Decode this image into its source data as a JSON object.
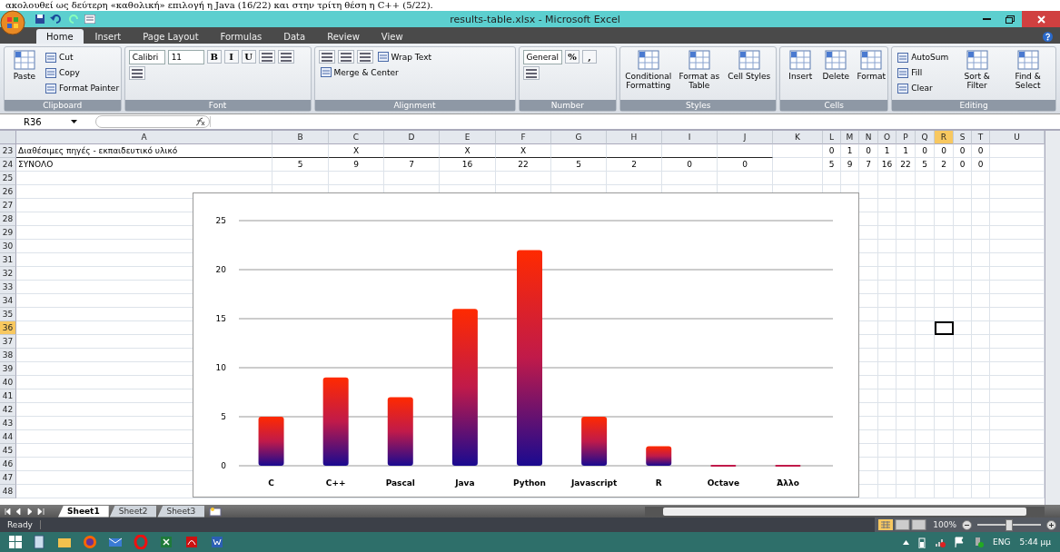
{
  "document_fragment": "ακολουθεί ως δεύτερη «καθολική» επιλογή η Java (16/22) και στην τρίτη θέση η C++ (5/22).",
  "window": {
    "title": "results-table.xlsx - Microsoft Excel"
  },
  "tabs": [
    {
      "label": "Home",
      "selected": true
    },
    {
      "label": "Insert",
      "selected": false
    },
    {
      "label": "Page Layout",
      "selected": false
    },
    {
      "label": "Formulas",
      "selected": false
    },
    {
      "label": "Data",
      "selected": false
    },
    {
      "label": "Review",
      "selected": false
    },
    {
      "label": "View",
      "selected": false
    }
  ],
  "ribbon": [
    {
      "label": "Clipboard",
      "items": [
        {
          "kind": "large",
          "label": "Paste"
        },
        {
          "kind": "small",
          "label": "Cut"
        },
        {
          "kind": "small",
          "label": "Copy"
        },
        {
          "kind": "small",
          "label": "Format Painter"
        }
      ]
    },
    {
      "label": "Font",
      "items": [
        {
          "kind": "combo",
          "label": "Calibri"
        },
        {
          "kind": "combo",
          "label": "11"
        },
        {
          "kind": "glyph",
          "label": "B"
        },
        {
          "kind": "glyph",
          "label": "I"
        },
        {
          "kind": "glyph",
          "label": "U"
        },
        {
          "kind": "icon"
        },
        {
          "kind": "icon"
        },
        {
          "kind": "icon"
        }
      ]
    },
    {
      "label": "Alignment",
      "items": [
        {
          "kind": "icon"
        },
        {
          "kind": "icon"
        },
        {
          "kind": "icon"
        },
        {
          "kind": "small",
          "label": "Wrap Text"
        },
        {
          "kind": "small",
          "label": "Merge & Center"
        }
      ]
    },
    {
      "label": "Number",
      "items": [
        {
          "kind": "combo",
          "label": "General"
        },
        {
          "kind": "glyph",
          "label": "%"
        },
        {
          "kind": "glyph",
          "label": ","
        },
        {
          "kind": "icon"
        }
      ]
    },
    {
      "label": "Styles",
      "items": [
        {
          "kind": "large",
          "label": "Conditional Formatting"
        },
        {
          "kind": "large",
          "label": "Format as Table"
        },
        {
          "kind": "large",
          "label": "Cell Styles"
        }
      ]
    },
    {
      "label": "Cells",
      "items": [
        {
          "kind": "large",
          "label": "Insert"
        },
        {
          "kind": "large",
          "label": "Delete"
        },
        {
          "kind": "large",
          "label": "Format"
        }
      ]
    },
    {
      "label": "Editing",
      "items": [
        {
          "kind": "small",
          "label": "AutoSum"
        },
        {
          "kind": "small",
          "label": "Fill"
        },
        {
          "kind": "small",
          "label": "Clear"
        },
        {
          "kind": "large",
          "label": "Sort & Filter"
        },
        {
          "kind": "large",
          "label": "Find & Select"
        }
      ]
    }
  ],
  "formula_bar": {
    "name_box": "R36"
  },
  "columns": [
    {
      "label": "A",
      "selected": false
    },
    {
      "label": "B",
      "selected": false
    },
    {
      "label": "C",
      "selected": false
    },
    {
      "label": "D",
      "selected": false
    },
    {
      "label": "E",
      "selected": false
    },
    {
      "label": "F",
      "selected": false
    },
    {
      "label": "G",
      "selected": false
    },
    {
      "label": "H",
      "selected": false
    },
    {
      "label": "I",
      "selected": false
    },
    {
      "label": "J",
      "selected": false
    },
    {
      "label": "K",
      "selected": false
    },
    {
      "label": "L",
      "selected": false
    },
    {
      "label": "M",
      "selected": false
    },
    {
      "label": "N",
      "selected": false
    },
    {
      "label": "O",
      "selected": false
    },
    {
      "label": "P",
      "selected": false
    },
    {
      "label": "Q",
      "selected": false
    },
    {
      "label": "R",
      "selected": true
    },
    {
      "label": "S",
      "selected": false
    },
    {
      "label": "T",
      "selected": false
    },
    {
      "label": "U",
      "selected": false
    }
  ],
  "rows": [
    {
      "number": "23",
      "selected": false,
      "cells": {
        "A": "Διαθέσιμες πηγές - εκπαιδευτικό υλικό",
        "C": "X",
        "E": "X",
        "F": "X",
        "L": "0",
        "M": "1",
        "N": "0",
        "O": "1",
        "P": "1",
        "Q": "0",
        "R": "0",
        "S": "0",
        "T": "0"
      }
    },
    {
      "number": "24",
      "selected": false,
      "cells": {
        "A": "ΣΥΝΟΛΟ",
        "B": "5",
        "C": "9",
        "D": "7",
        "E": "16",
        "F": "22",
        "G": "5",
        "H": "2",
        "I": "0",
        "J": "0",
        "L": "5",
        "M": "9",
        "N": "7",
        "O": "16",
        "P": "22",
        "Q": "5",
        "R": "2",
        "S": "0",
        "T": "0"
      }
    },
    {
      "number": "25",
      "selected": false
    },
    {
      "number": "26",
      "selected": false
    },
    {
      "number": "27",
      "selected": false
    },
    {
      "number": "28",
      "selected": false
    },
    {
      "number": "29",
      "selected": false
    },
    {
      "number": "30",
      "selected": false
    },
    {
      "number": "31",
      "selected": false
    },
    {
      "number": "32",
      "selected": false
    },
    {
      "number": "33",
      "selected": false
    },
    {
      "number": "34",
      "selected": false
    },
    {
      "number": "35",
      "selected": false
    },
    {
      "number": "36",
      "selected": true
    },
    {
      "number": "37",
      "selected": false
    },
    {
      "number": "38",
      "selected": false
    },
    {
      "number": "39",
      "selected": false
    },
    {
      "number": "40",
      "selected": false
    },
    {
      "number": "41",
      "selected": false
    },
    {
      "number": "42",
      "selected": false
    },
    {
      "number": "43",
      "selected": false
    },
    {
      "number": "44",
      "selected": false
    },
    {
      "number": "45",
      "selected": false
    },
    {
      "number": "46",
      "selected": false
    },
    {
      "number": "47",
      "selected": false
    },
    {
      "number": "48",
      "selected": false
    }
  ],
  "chart": {
    "chart_data": {
      "type": "bar",
      "categories": [
        "C",
        "C++",
        "Pascal",
        "Java",
        "Python",
        "Javascript",
        "R",
        "Octave",
        "Άλλο"
      ],
      "series": [
        {
          "color": "#c01a4a",
          "values": [
            5,
            9,
            7,
            16,
            22,
            5,
            2,
            0,
            0
          ]
        }
      ],
      "grid": true,
      "ylim": [
        0,
        25
      ],
      "yticks": [
        {
          "value": 0,
          "label": "0"
        },
        {
          "value": 5,
          "label": "5"
        },
        {
          "value": 10,
          "label": "10"
        },
        {
          "value": 15,
          "label": "15"
        },
        {
          "value": 20,
          "label": "20"
        },
        {
          "value": 25,
          "label": "25"
        }
      ]
    }
  },
  "sheet_tabs": [
    {
      "label": "Sheet1",
      "selected": true
    },
    {
      "label": "Sheet2",
      "selected": false
    },
    {
      "label": "Sheet3",
      "selected": false
    }
  ],
  "status_bar": {
    "status": "Ready",
    "zoom": "100%",
    "zoom_slider": {
      "level": 0.5
    }
  },
  "taskbar": {
    "language": "ENG",
    "time": "5:44 μμ"
  }
}
